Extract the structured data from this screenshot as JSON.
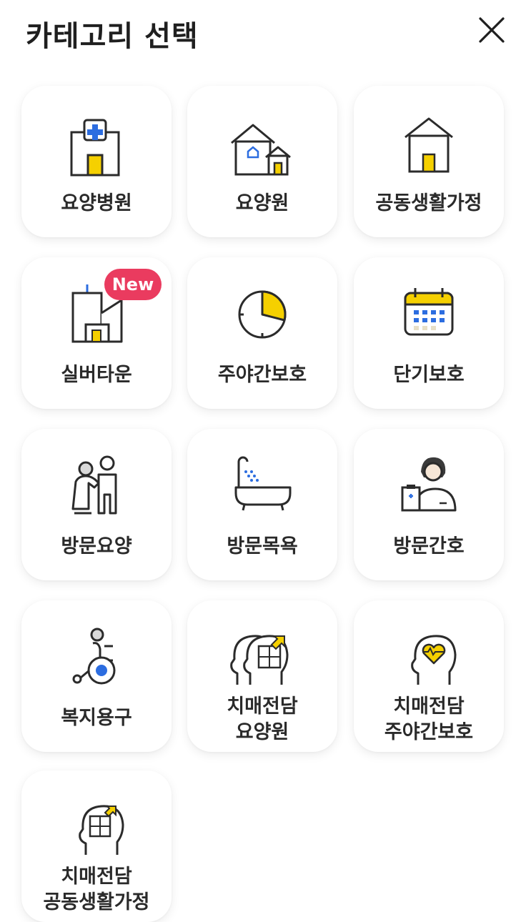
{
  "header": {
    "title": "카테고리 선택"
  },
  "colors": {
    "accent_yellow": "#f5d000",
    "accent_blue": "#2c6de0",
    "badge_red": "#ea3b5f"
  },
  "categories": [
    {
      "label": "요양병원",
      "icon": "hospital-icon"
    },
    {
      "label": "요양원",
      "icon": "houses-icon"
    },
    {
      "label": "공동생활가정",
      "icon": "home-icon"
    },
    {
      "label": "실버타운",
      "icon": "buildings-icon",
      "badge": "New"
    },
    {
      "label": "주야간보호",
      "icon": "clock-icon"
    },
    {
      "label": "단기보호",
      "icon": "calendar-icon"
    },
    {
      "label": "방문요양",
      "icon": "caregiver-icon"
    },
    {
      "label": "방문목욕",
      "icon": "bathtub-icon"
    },
    {
      "label": "방문간호",
      "icon": "nurse-icon"
    },
    {
      "label": "복지용구",
      "icon": "wheelchair-icon"
    },
    {
      "label": "치매전담\n요양원",
      "line1": "치매전담",
      "line2": "요양원",
      "icon": "dementia-puzzle-icon"
    },
    {
      "label": "치매전담\n주야간보호",
      "line1": "치매전담",
      "line2": "주야간보호",
      "icon": "brain-heart-icon"
    },
    {
      "label": "치매전담\n공동생활가정",
      "line1": "치매전담",
      "line2": "공동생활가정",
      "icon": "head-puzzle-icon"
    }
  ]
}
